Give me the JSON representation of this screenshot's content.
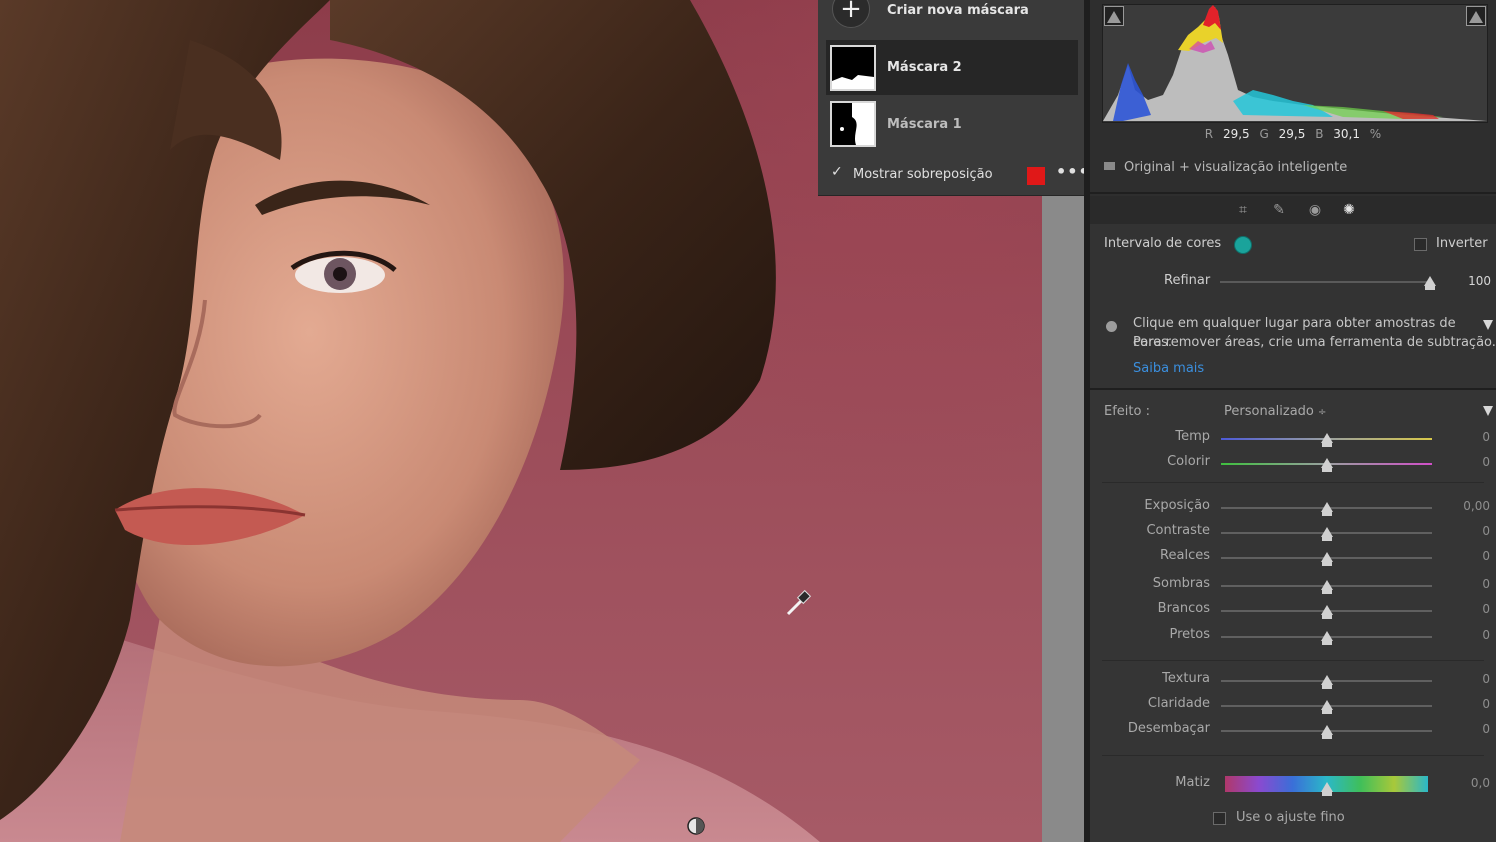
{
  "masks": {
    "create_label": "Criar nova máscara",
    "items": [
      {
        "label": "Máscara 2"
      },
      {
        "label": "Máscara 1"
      }
    ],
    "overlay_label": "Mostrar sobreposição",
    "overlay_checked": true,
    "overlay_color": "#e01818",
    "more_label": "•••"
  },
  "histogram": {
    "r_key": "R",
    "r_val": "29,5",
    "g_key": "G",
    "g_val": "29,5",
    "b_key": "B",
    "b_val": "30,1",
    "unit": "%"
  },
  "preview_label": "Original + visualização inteligente",
  "color_range": {
    "title": "Intervalo de cores",
    "invert_label": "Inverter",
    "refine_label": "Refinar",
    "refine_value": "100",
    "refine_level": 1.0,
    "tip_line1": "Clique em qualquer lugar para obter amostras de cores.",
    "tip_line2": "Para remover áreas, crie uma ferramenta de subtração.",
    "learn_more": "Saiba mais"
  },
  "effects": {
    "label": "Efeito :",
    "preset": "Personalizado",
    "preset_arrow": "÷",
    "sliders": [
      {
        "label": "Temp",
        "value": "0"
      },
      {
        "label": "Colorir",
        "value": "0"
      },
      {
        "label": "Exposição",
        "value": "0,00"
      },
      {
        "label": "Contraste",
        "value": "0"
      },
      {
        "label": "Realces",
        "value": "0"
      },
      {
        "label": "Sombras",
        "value": "0"
      },
      {
        "label": "Brancos",
        "value": "0"
      },
      {
        "label": "Pretos",
        "value": "0"
      },
      {
        "label": "Textura",
        "value": "0"
      },
      {
        "label": "Claridade",
        "value": "0"
      },
      {
        "label": "Desembaçar",
        "value": "0"
      },
      {
        "label": "Matiz",
        "value": "0,0"
      }
    ],
    "fine_tune_label": "Use o ajuste fino"
  },
  "colors": {
    "accent_link": "#3b8fde",
    "teal": "#1aa39b"
  }
}
